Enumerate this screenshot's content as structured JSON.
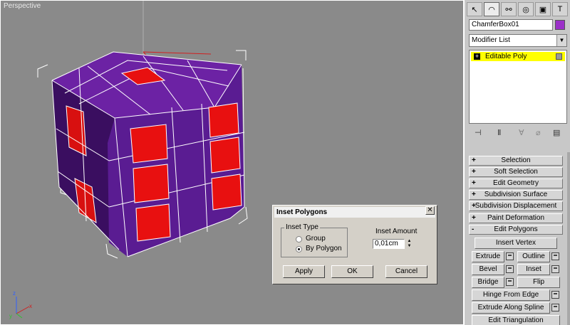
{
  "viewport": {
    "label": "Perspective"
  },
  "command_panel": {
    "tabs": [
      "create-icon",
      "modify-icon",
      "hierarchy-icon",
      "motion-icon",
      "display-icon",
      "utilities-icon"
    ],
    "object_name": "ChamferBox01",
    "object_color": "#9b30c8",
    "modifier_list": "Modifier List",
    "stack": [
      {
        "label": "Editable Poly",
        "selected": true
      }
    ]
  },
  "rollouts": [
    {
      "sign": "+",
      "label": "Selection"
    },
    {
      "sign": "+",
      "label": "Soft Selection"
    },
    {
      "sign": "+",
      "label": "Edit Geometry"
    },
    {
      "sign": "+",
      "label": "Subdivision Surface"
    },
    {
      "sign": "+",
      "label": "Subdivision Displacement"
    },
    {
      "sign": "+",
      "label": "Paint Deformation"
    },
    {
      "sign": "-",
      "label": "Edit Polygons"
    }
  ],
  "edit_polygons": {
    "insert_vertex": "Insert Vertex",
    "extrude": "Extrude",
    "outline": "Outline",
    "bevel": "Bevel",
    "inset": "Inset",
    "bridge": "Bridge",
    "flip": "Flip",
    "hinge_from_edge": "Hinge From Edge",
    "extrude_along_spline": "Extrude Along Spline",
    "edit_triangulation": "Edit Triangulation"
  },
  "dialog": {
    "title": "Inset Polygons",
    "close": "✕",
    "inset_type_label": "Inset Type",
    "options": [
      "Group",
      "By Polygon"
    ],
    "selected_option": "By Polygon",
    "inset_amount_label": "Inset Amount",
    "inset_amount_value": "0,01cm",
    "apply": "Apply",
    "ok": "OK",
    "cancel": "Cancel"
  },
  "colors": {
    "viewport_bg": "#8a8a8a",
    "box_purple": "#6a1fa0",
    "inset_red": "#e81010",
    "selection_yellow": "#ffff00"
  }
}
